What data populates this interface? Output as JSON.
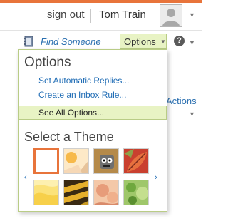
{
  "header": {
    "sign_out": "sign out",
    "user_name": "Tom Train"
  },
  "toolbar": {
    "find_someone": "Find Someone",
    "options_label": "Options"
  },
  "background": {
    "actions_label": "Actions"
  },
  "options_menu": {
    "title": "Options",
    "items": [
      {
        "label": "Set Automatic Replies..."
      },
      {
        "label": "Create an Inbox Rule..."
      },
      {
        "label": "See All Options..."
      }
    ],
    "theme_title": "Select a Theme",
    "themes": [
      {
        "name": "default-theme",
        "selected": true
      },
      {
        "name": "sun-theme",
        "selected": false
      },
      {
        "name": "robot-theme",
        "selected": false
      },
      {
        "name": "leaf-theme",
        "selected": false
      },
      {
        "name": "yellow-theme",
        "selected": false
      },
      {
        "name": "bee-theme",
        "selected": false
      },
      {
        "name": "peach-theme",
        "selected": false
      },
      {
        "name": "green-theme",
        "selected": false
      }
    ]
  },
  "colors": {
    "accent": "#e8743b",
    "link": "#1f6cb5",
    "highlight": "#e8f3c4",
    "highlight_border": "#b9cc86"
  }
}
